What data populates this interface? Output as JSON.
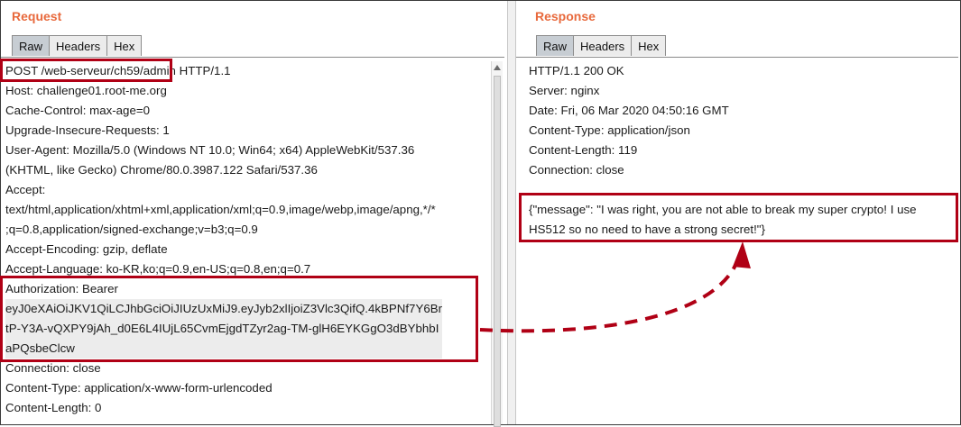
{
  "colors": {
    "title": "#e8693c",
    "highlight_box": "#b00015",
    "active_tab": "#c7cdd3"
  },
  "request": {
    "title": "Request",
    "tabs": [
      "Raw",
      "Headers",
      "Hex"
    ],
    "lines": [
      "POST /web-serveur/ch59/admin HTTP/1.1",
      "Host: challenge01.root-me.org",
      "Cache-Control: max-age=0",
      "Upgrade-Insecure-Requests: 1",
      "User-Agent: Mozilla/5.0 (Windows NT 10.0; Win64; x64) AppleWebKit/537.36",
      "(KHTML, like Gecko) Chrome/80.0.3987.122 Safari/537.36",
      "Accept:",
      "text/html,application/xhtml+xml,application/xml;q=0.9,image/webp,image/apng,*/*",
      ";q=0.8,application/signed-exchange;v=b3;q=0.9",
      "Accept-Encoding: gzip, deflate",
      "Accept-Language: ko-KR,ko;q=0.9,en-US;q=0.8,en;q=0.7",
      "Authorization: Bearer",
      "eyJ0eXAiOiJKV1QiLCJhbGciOiJIUzUxMiJ9.eyJyb2xlIjoiZ3Vlc3QifQ.4kBPNf7Y6Br",
      "tP-Y3A-vQXPY9jAh_d0E6L4IUjL65CvmEjgdTZyr2ag-TM-glH6EYKGgO3dBYbhbI",
      "aPQsbeClcw",
      "Connection: close",
      "Content-Type: application/x-www-form-urlencoded",
      "Content-Length: 0"
    ]
  },
  "response": {
    "title": "Response",
    "tabs": [
      "Raw",
      "Headers",
      "Hex"
    ],
    "lines": [
      "HTTP/1.1 200 OK",
      "Server: nginx",
      "Date: Fri, 06 Mar 2020 04:50:16 GMT",
      "Content-Type: application/json",
      "Content-Length: 119",
      "Connection: close",
      "",
      "{\"message\": \"I was right, you are not able to break my super crypto! I use",
      "HS512 so no need to have a strong secret!\"}"
    ]
  }
}
